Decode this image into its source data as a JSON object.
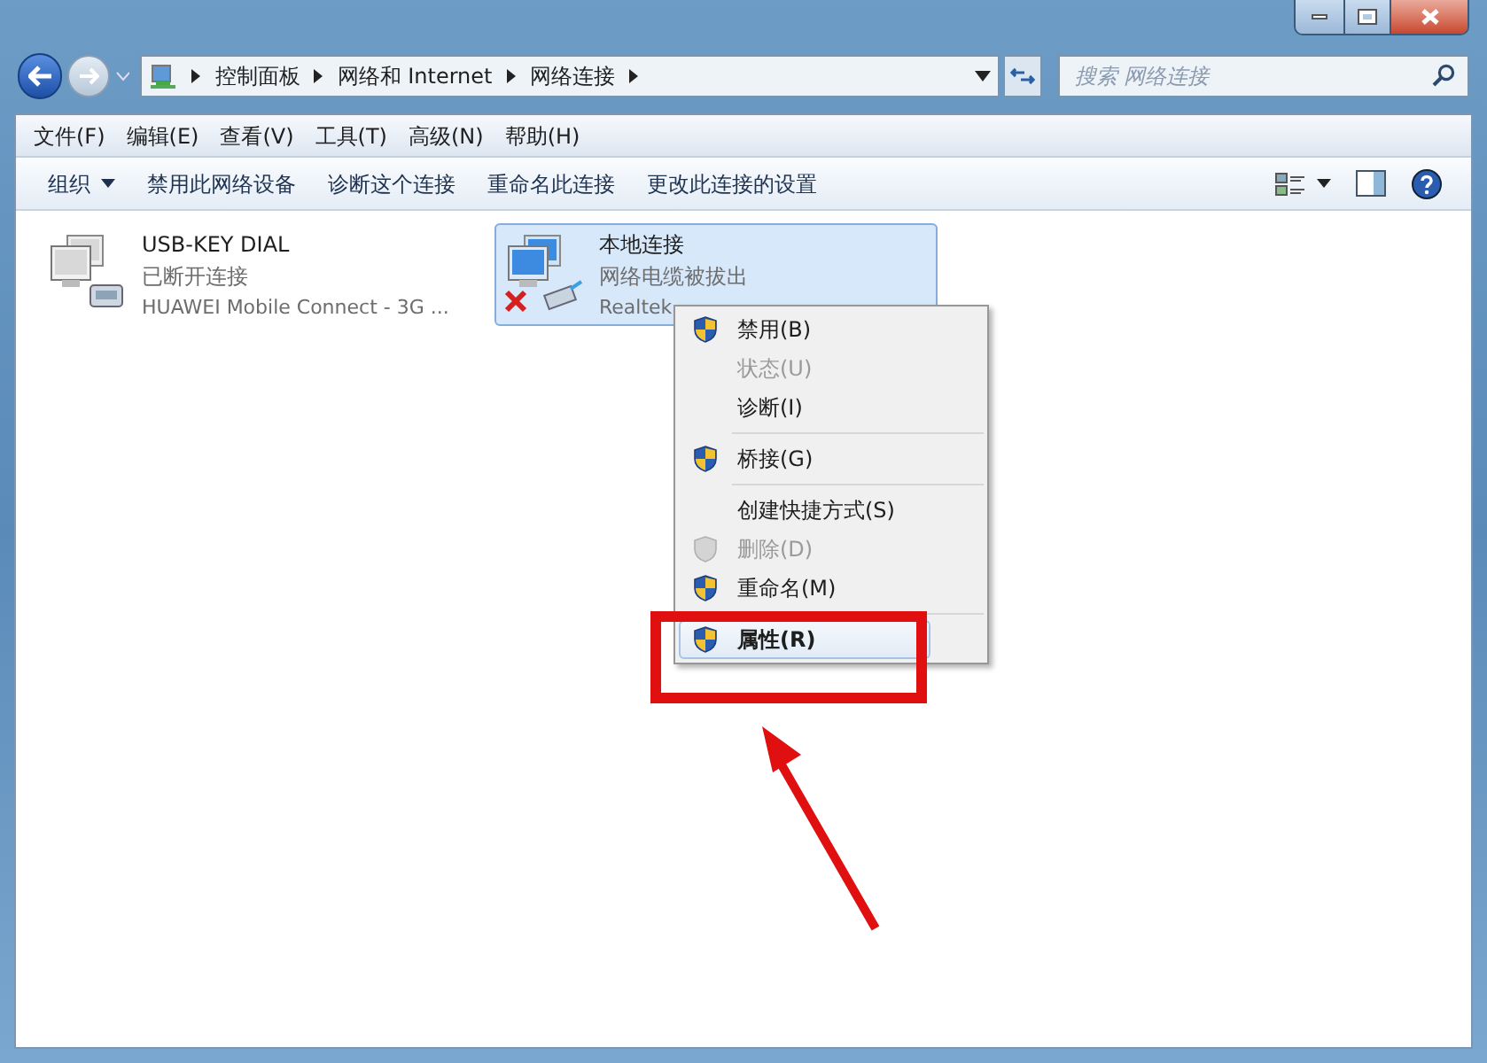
{
  "breadcrumb": [
    "控制面板",
    "网络和 Internet",
    "网络连接"
  ],
  "search": {
    "placeholder": "搜索 网络连接"
  },
  "menu_bar": [
    "文件(F)",
    "编辑(E)",
    "查看(V)",
    "工具(T)",
    "高级(N)",
    "帮助(H)"
  ],
  "toolbar": [
    {
      "label": "组织",
      "has_menu": true
    },
    {
      "label": "禁用此网络设备",
      "has_menu": false
    },
    {
      "label": "诊断这个连接",
      "has_menu": false
    },
    {
      "label": "重命名此连接",
      "has_menu": false
    },
    {
      "label": "更改此连接的设置",
      "has_menu": false
    }
  ],
  "connections": [
    {
      "name": "USB-KEY DIAL",
      "status": "已断开连接",
      "device": "HUAWEI Mobile Connect - 3G ...",
      "selected": false,
      "kind": "dialup",
      "cable_unplugged": false
    },
    {
      "name": "本地连接",
      "status": "网络电缆被拔出",
      "device": "Realtek",
      "selected": true,
      "kind": "lan",
      "cable_unplugged": true
    }
  ],
  "context_menu": [
    [
      {
        "label": "禁用(B)",
        "shield": true,
        "disabled": false,
        "selected": false,
        "default": false
      },
      {
        "label": "状态(U)",
        "shield": false,
        "disabled": true,
        "selected": false,
        "default": false
      },
      {
        "label": "诊断(I)",
        "shield": false,
        "disabled": false,
        "selected": false,
        "default": false
      }
    ],
    [
      {
        "label": "桥接(G)",
        "shield": true,
        "disabled": false,
        "selected": false,
        "default": false
      }
    ],
    [
      {
        "label": "创建快捷方式(S)",
        "shield": false,
        "disabled": false,
        "selected": false,
        "default": false
      },
      {
        "label": "删除(D)",
        "shield": true,
        "disabled": true,
        "selected": false,
        "default": false
      },
      {
        "label": "重命名(M)",
        "shield": true,
        "disabled": false,
        "selected": false,
        "default": false
      }
    ],
    [
      {
        "label": "属性(R)",
        "shield": true,
        "disabled": false,
        "selected": true,
        "default": true
      }
    ]
  ]
}
